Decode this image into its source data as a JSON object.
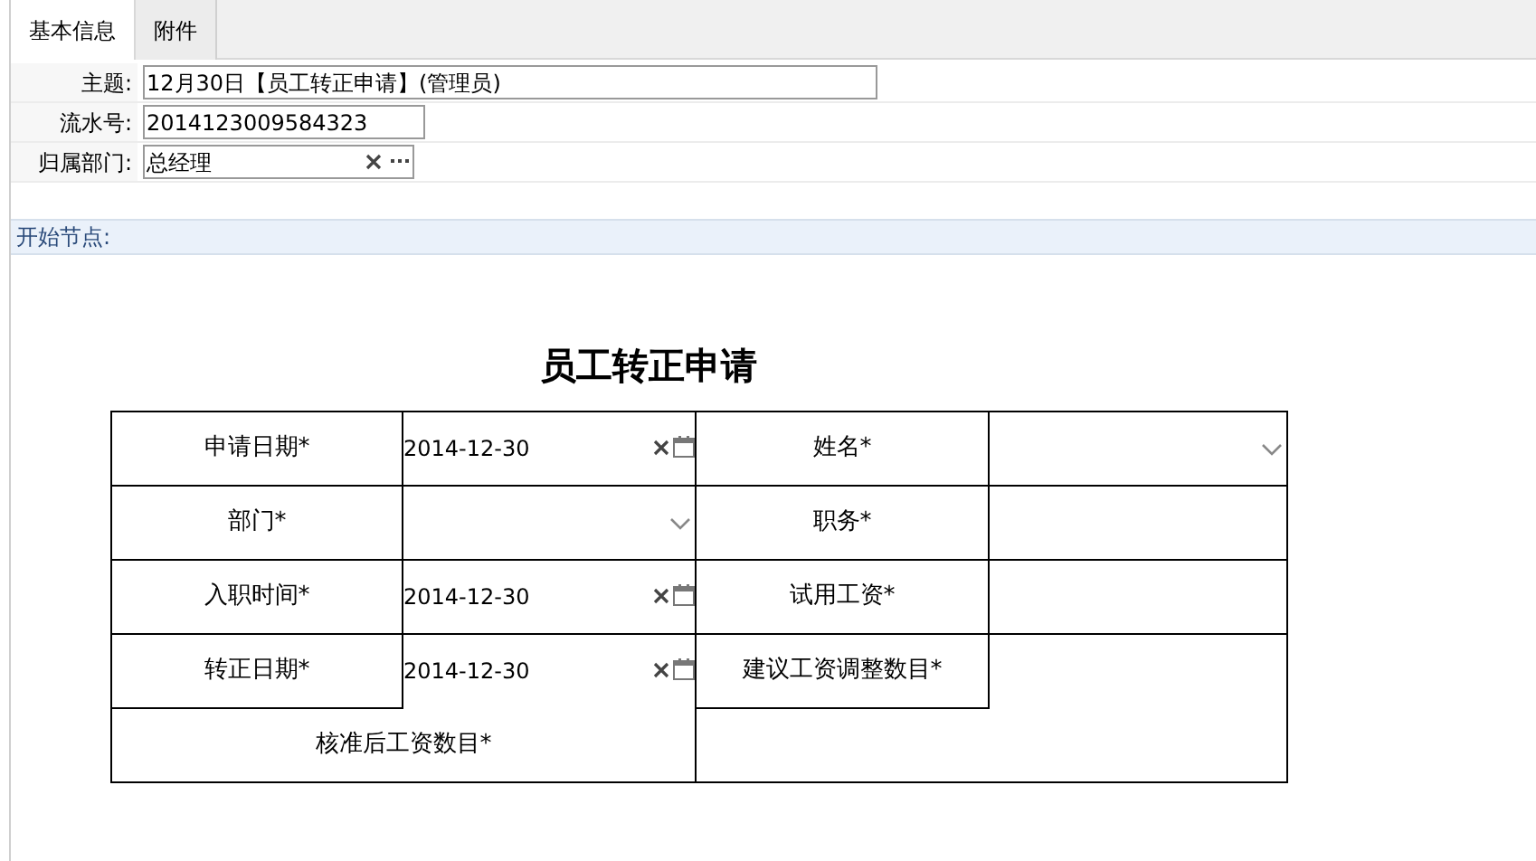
{
  "tabs": [
    {
      "label": "基本信息",
      "selected": true
    },
    {
      "label": "附件",
      "selected": false
    }
  ],
  "header_fields": [
    {
      "label": "主题:",
      "value": "12月30日【员工转正申请】(管理员)",
      "kind": "text"
    },
    {
      "label": "流水号:",
      "value": "2014123009584323",
      "kind": "text"
    },
    {
      "label": "归属部门:",
      "value": "总经理",
      "kind": "picker"
    }
  ],
  "section": {
    "label": "开始节点:"
  },
  "form": {
    "title": "员工转正申请",
    "cells": [
      {
        "kind": "label",
        "text": "申请日期*"
      },
      {
        "kind": "date",
        "value": "2014-12-30"
      },
      {
        "kind": "label",
        "text": "姓名*"
      },
      {
        "kind": "select"
      },
      {
        "kind": "label",
        "text": "部门*"
      },
      {
        "kind": "select"
      },
      {
        "kind": "label",
        "text": "职务*"
      },
      {
        "kind": "empty"
      },
      {
        "kind": "label",
        "text": "入职时间*"
      },
      {
        "kind": "date",
        "value": "2014-12-30"
      },
      {
        "kind": "label",
        "text": "试用工资*"
      },
      {
        "kind": "empty"
      },
      {
        "kind": "label",
        "text": "转正日期*"
      },
      {
        "kind": "date",
        "value": "2014-12-30"
      },
      {
        "kind": "label",
        "text": "建议工资调整数目*"
      },
      {
        "kind": "empty"
      },
      {
        "kind": "label",
        "text": "核准后工资数目*"
      },
      {
        "kind": "empty"
      }
    ]
  }
}
